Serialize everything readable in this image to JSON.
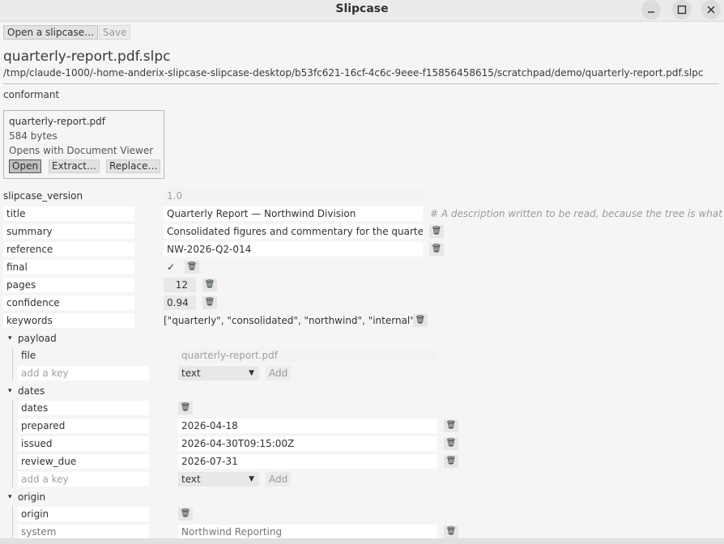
{
  "window": {
    "title": "Slipcase",
    "minimize": "_",
    "maximize": "□",
    "close": "✕"
  },
  "toolbar": {
    "open_label": "Open a slipcase…",
    "save_label": "Save"
  },
  "file": {
    "name": "quarterly-report.pdf.slpc",
    "path": "/tmp/claude-1000/-home-anderix-slipcase-slipcase-desktop/b53fc621-16cf-4c6c-9eee-f15856458615/scratchpad/demo/quarterly-report.pdf.slpc",
    "status": "conformant"
  },
  "payload_card": {
    "filename": "quarterly-report.pdf",
    "size": "584 bytes",
    "opens_with": "Opens with Document Viewer",
    "open_label": "Open",
    "extract_label": "Extract…",
    "replace_label": "Replace…"
  },
  "fields": {
    "slipcase_version": {
      "key": "slipcase_version",
      "value": "1.0"
    },
    "title": {
      "key": "title",
      "value": "Quarterly Report — Northwind Division",
      "comment": "# A description written to be read, because the tree is what a p"
    },
    "summary": {
      "key": "summary",
      "value": "Consolidated figures and commentary for the quarter."
    },
    "reference": {
      "key": "reference",
      "value": "NW-2026-Q2-014"
    },
    "final": {
      "key": "final",
      "value": "✓"
    },
    "pages": {
      "key": "pages",
      "value": "12"
    },
    "confidence": {
      "key": "confidence",
      "value": "0.94"
    },
    "keywords": {
      "key": "keywords",
      "value": "[\"quarterly\", \"consolidated\", \"northwind\", \"internal\"]"
    }
  },
  "payload_group": {
    "label": "payload",
    "file_key": "file",
    "file_value": "quarterly-report.pdf",
    "add_key_placeholder": "add a key",
    "type": "text",
    "add_label": "Add"
  },
  "dates_group": {
    "label": "dates",
    "dates_key": "dates",
    "prepared_key": "prepared",
    "prepared_value": "2026-04-18",
    "issued_key": "issued",
    "issued_value": "2026-04-30T09:15:00Z",
    "review_key": "review_due",
    "review_value": "2026-07-31",
    "add_key_placeholder": "add a key",
    "type": "text",
    "add_label": "Add"
  },
  "origin_group": {
    "label": "origin",
    "origin_key": "origin",
    "system_key": "system",
    "system_value": "Northwind Reporting"
  },
  "icons": {
    "trash": "trash-icon",
    "expander": "▾"
  }
}
